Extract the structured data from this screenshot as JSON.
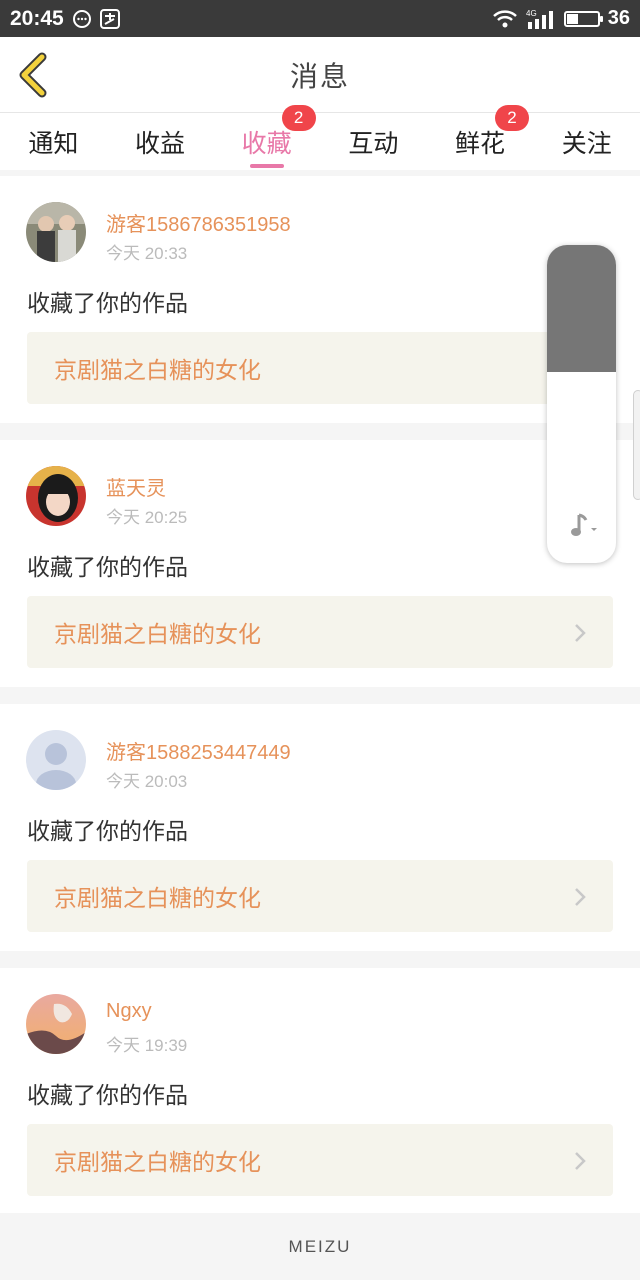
{
  "status_bar": {
    "time": "20:45",
    "network": "4G",
    "battery": "36",
    "battery_level": 0.36
  },
  "nav": {
    "title": "消息"
  },
  "tabs": [
    {
      "label": "通知",
      "badge": null,
      "active": false
    },
    {
      "label": "收益",
      "badge": null,
      "active": false
    },
    {
      "label": "收藏",
      "badge": "2",
      "active": true
    },
    {
      "label": "互动",
      "badge": null,
      "active": false
    },
    {
      "label": "鲜花",
      "badge": "2",
      "active": false
    },
    {
      "label": "关注",
      "badge": null,
      "active": false
    }
  ],
  "feed": [
    {
      "username": "游客1586786351958",
      "time": "今天 20:33",
      "action": "收藏了你的作品",
      "work_title": "京剧猫之白糖的女化"
    },
    {
      "username": "蓝天灵",
      "time": "今天 20:25",
      "action": "收藏了你的作品",
      "work_title": "京剧猫之白糖的女化"
    },
    {
      "username": "游客1588253447449",
      "time": "今天 20:03",
      "action": "收藏了你的作品",
      "work_title": "京剧猫之白糖的女化"
    },
    {
      "username": "Ngxy",
      "time": "今天 19:39",
      "action": "收藏了你的作品",
      "work_title": "京剧猫之白糖的女化"
    }
  ],
  "volume_overlay": {
    "level": 0.6,
    "icon": "music-note-icon"
  },
  "footer": {
    "brand": "MEIZU"
  },
  "colors": {
    "accent": "#e878a8",
    "username": "#e6925a",
    "badge": "#f0454a",
    "back_arrow": "#f3d23c"
  }
}
